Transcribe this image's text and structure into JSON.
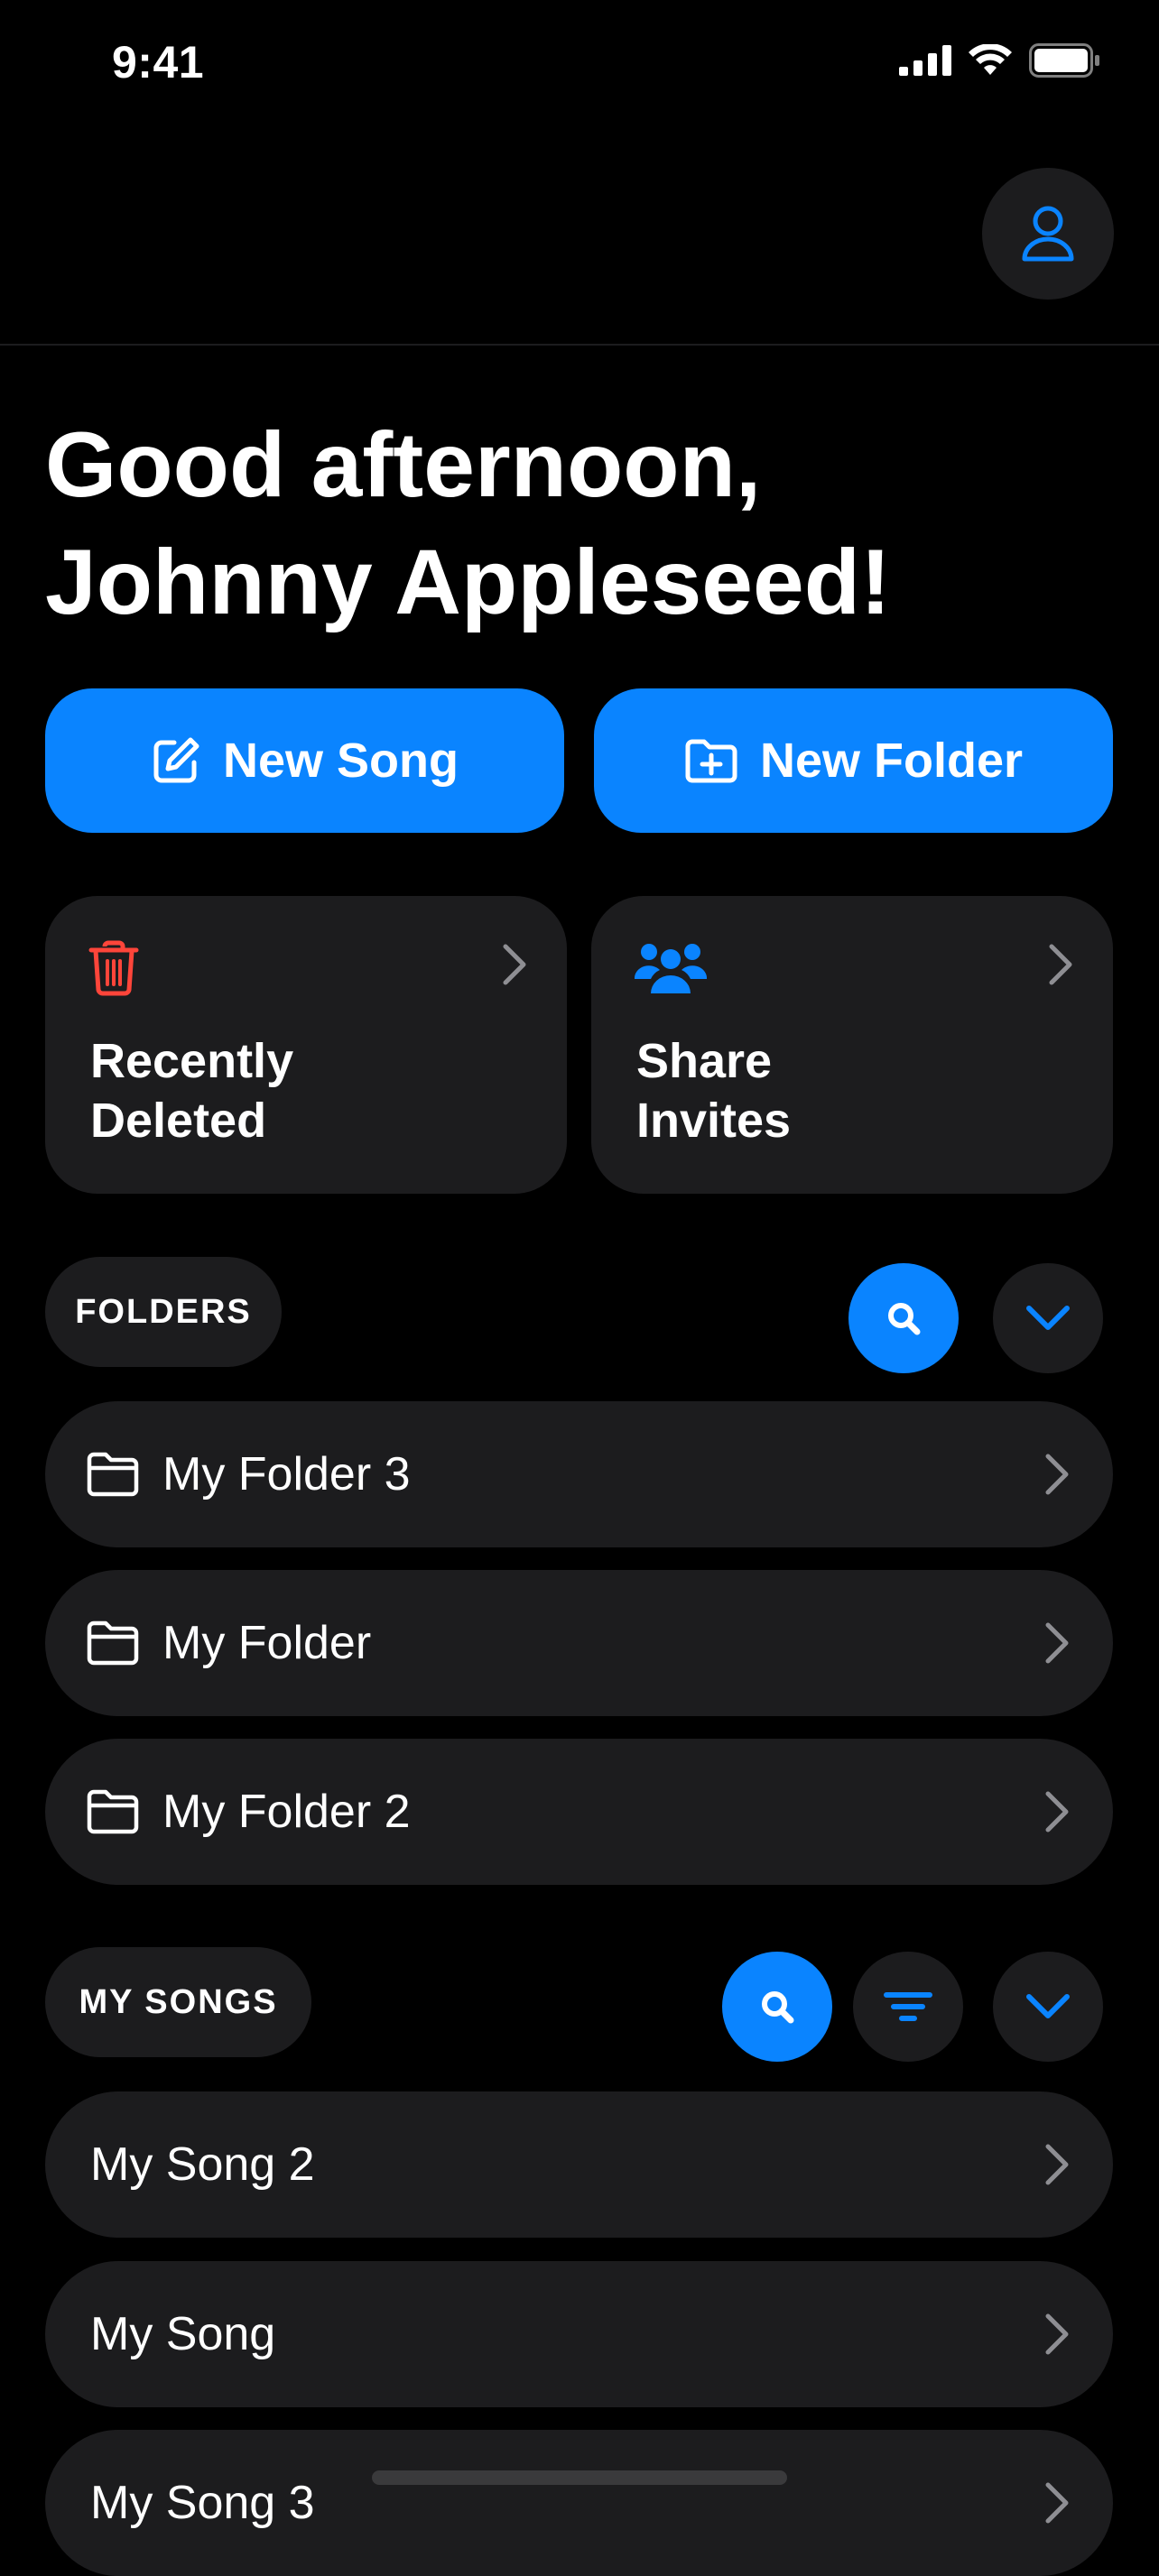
{
  "status_bar": {
    "time": "9:41"
  },
  "greeting": {
    "line1": "Good afternoon,",
    "line2": "Johnny Appleseed!"
  },
  "actions": {
    "new_song": "New Song",
    "new_folder": "New Folder"
  },
  "cards": {
    "recently_deleted": {
      "line1": "Recently",
      "line2": "Deleted",
      "icon": "trash-icon"
    },
    "share_invites": {
      "line1": "Share",
      "line2": "Invites",
      "icon": "people-icon"
    }
  },
  "folders": {
    "header": "FOLDERS",
    "items": [
      {
        "label": "My Folder 3"
      },
      {
        "label": "My Folder"
      },
      {
        "label": "My Folder 2"
      }
    ]
  },
  "songs": {
    "header": "MY SONGS",
    "items": [
      {
        "label": "My Song 2"
      },
      {
        "label": "My Song"
      },
      {
        "label": "My Song 3"
      }
    ]
  },
  "colors": {
    "accent": "#0a84ff",
    "surface": "#1c1c1e",
    "danger": "#ff453a",
    "background": "#000000"
  }
}
